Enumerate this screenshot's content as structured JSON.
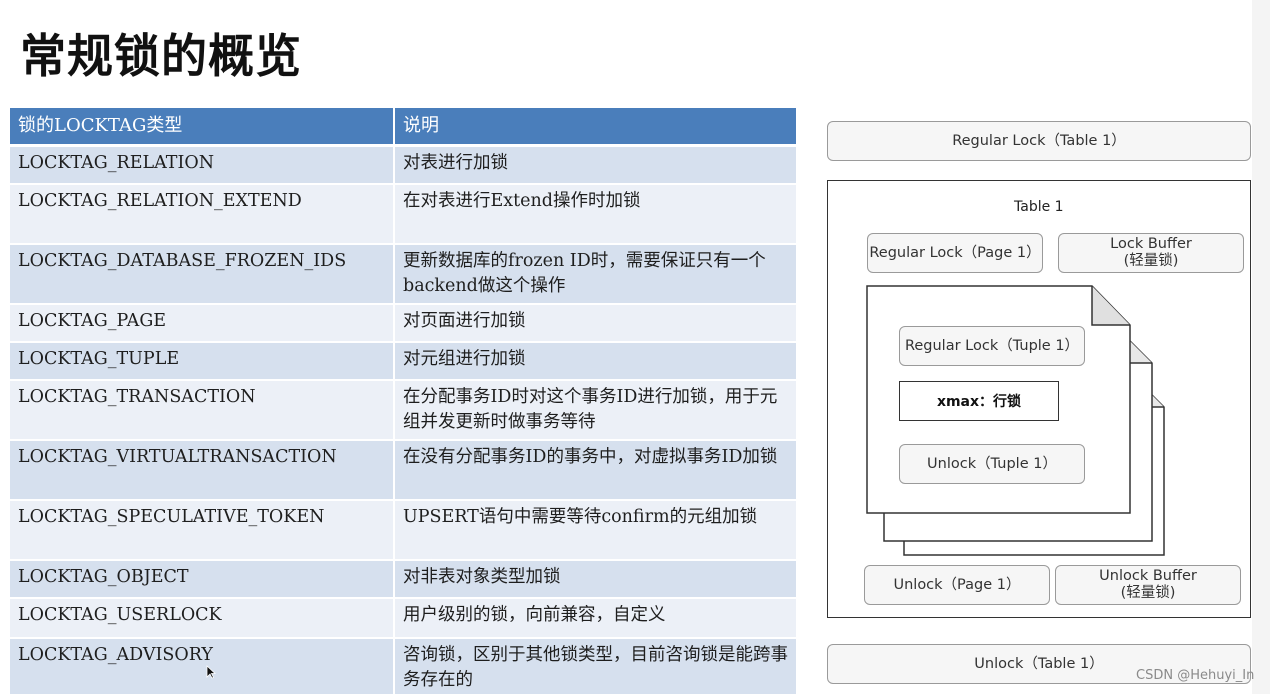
{
  "page": {
    "title": "常规锁的概览"
  },
  "table": {
    "headers": [
      "锁的LOCKTAG类型",
      "说明"
    ],
    "rows": [
      {
        "type": "LOCKTAG_RELATION",
        "desc": "对表进行加锁"
      },
      {
        "type": "LOCKTAG_RELATION_EXTEND",
        "desc": "在对表进行Extend操作时加锁"
      },
      {
        "type": "LOCKTAG_DATABASE_FROZEN_IDS",
        "desc": "更新数据库的frozen ID时，需要保证只有一个backend做这个操作"
      },
      {
        "type": "LOCKTAG_PAGE",
        "desc": "对页面进行加锁"
      },
      {
        "type": "LOCKTAG_TUPLE",
        "desc": "对元组进行加锁"
      },
      {
        "type": "LOCKTAG_TRANSACTION",
        "desc": "在分配事务ID时对这个事务ID进行加锁，用于元组并发更新时做事务等待"
      },
      {
        "type": "LOCKTAG_VIRTUALTRANSACTION",
        "desc": "在没有分配事务ID的事务中，对虚拟事务ID加锁"
      },
      {
        "type": "LOCKTAG_SPECULATIVE_TOKEN",
        "desc": "UPSERT语句中需要等待confirm的元组加锁"
      },
      {
        "type": "LOCKTAG_OBJECT",
        "desc": "对非表对象类型加锁"
      },
      {
        "type": "LOCKTAG_USERLOCK",
        "desc": "用户级别的锁，向前兼容，自定义"
      },
      {
        "type": "LOCKTAG_ADVISORY",
        "desc": "咨询锁，区别于其他锁类型，目前咨询锁是能跨事务存在的"
      }
    ]
  },
  "diagram": {
    "regular_lock_table": "Regular Lock（Table 1）",
    "table_label": "Table 1",
    "regular_lock_page": "Regular Lock（Page 1）",
    "lock_buffer_top": "Lock Buffer",
    "lock_buffer_top_note": "(轻量锁)",
    "regular_lock_tuple": "Regular Lock（Tuple 1）",
    "xmax": "xmax：行锁",
    "unlock_tuple": "Unlock（Tuple 1）",
    "unlock_page": "Unlock（Page 1）",
    "unlock_buffer": "Unlock Buffer",
    "unlock_buffer_note": "(轻量锁)",
    "unlock_table": "Unlock（Table 1）"
  },
  "watermark": "CSDN @Hehuyi_In",
  "colors": {
    "header": "#4a7ebb",
    "row_odd": "#d6e0ee",
    "row_even": "#ecf0f7"
  }
}
